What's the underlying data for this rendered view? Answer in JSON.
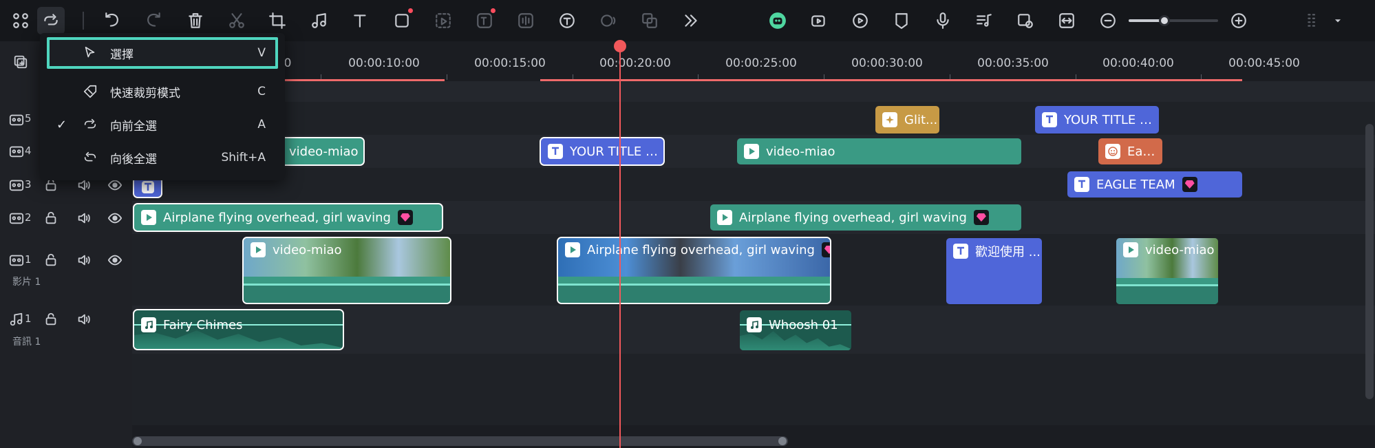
{
  "colors": {
    "accent": "#4fd6bf",
    "playhead": "#f2585b",
    "clip_green": "#3a9a84",
    "clip_blue": "#4f66d9",
    "clip_gold": "#c79a45",
    "clip_orange": "#d26a4a"
  },
  "toolbar": {
    "icons": [
      "grid-icon",
      "selection-tool-icon",
      "undo-icon",
      "redo-icon",
      "delete-icon",
      "cut-icon",
      "crop-icon",
      "audio-add-icon",
      "text-icon",
      "shape-icon",
      "smart-cutout-icon",
      "ai-text-icon",
      "audio-denoise-icon",
      "speech-to-text-icon",
      "text-to-speech-icon",
      "ai-translate-icon",
      "more-icon",
      "ai-copilot-icon",
      "ai-video-icon",
      "speed-icon",
      "marker-icon",
      "microphone-icon",
      "audio-beat-icon",
      "preview-render-icon",
      "fit-timeline-icon",
      "zoom-out-icon",
      "zoom-in-icon",
      "layout-icon"
    ],
    "zoom_level": 0.4
  },
  "menu": {
    "items": [
      {
        "label": "選擇",
        "key": "V",
        "checked": false,
        "icon": "cursor-icon"
      },
      {
        "label": "快速裁剪模式",
        "key": "C",
        "checked": false,
        "icon": "tag-icon"
      },
      {
        "label": "向前全選",
        "key": "A",
        "checked": true,
        "icon": "select-forward-icon"
      },
      {
        "label": "向後全選",
        "key": "Shift+A",
        "checked": false,
        "icon": "select-backward-icon"
      }
    ],
    "check_glyph": "✓"
  },
  "ruler": {
    "labels": [
      "0",
      "00:00:10:00",
      "00:00:15:00",
      "00:00:20:00",
      "00:00:25:00",
      "00:00:30:00",
      "00:00:35:00",
      "00:00:40:00",
      "00:00:45:00"
    ]
  },
  "tracks": {
    "v5": {
      "num": "5"
    },
    "v4": {
      "num": "4"
    },
    "v3": {
      "num": "3"
    },
    "v2": {
      "num": "2"
    },
    "v1": {
      "num": "1",
      "label": "影片 1"
    },
    "a1": {
      "num": "1",
      "label": "音訊 1"
    }
  },
  "clips": {
    "c1": "Glit...",
    "c2": "YOUR TITLE H...",
    "c3": "video-miao",
    "c4": "YOUR TITLE H...",
    "c5": "video-miao",
    "c6": "Eagl...",
    "c7": "EAGLE TEAM",
    "c8": "Airplane flying overhead, girl waving",
    "c9": "Airplane flying overhead, girl waving",
    "c10": "video-miao",
    "c11": "Airplane flying overhead, girl waving",
    "c12": "歡迎使用 ...",
    "c13": "video-miao",
    "c14": "Fairy Chimes",
    "c15": "Whoosh 01"
  }
}
